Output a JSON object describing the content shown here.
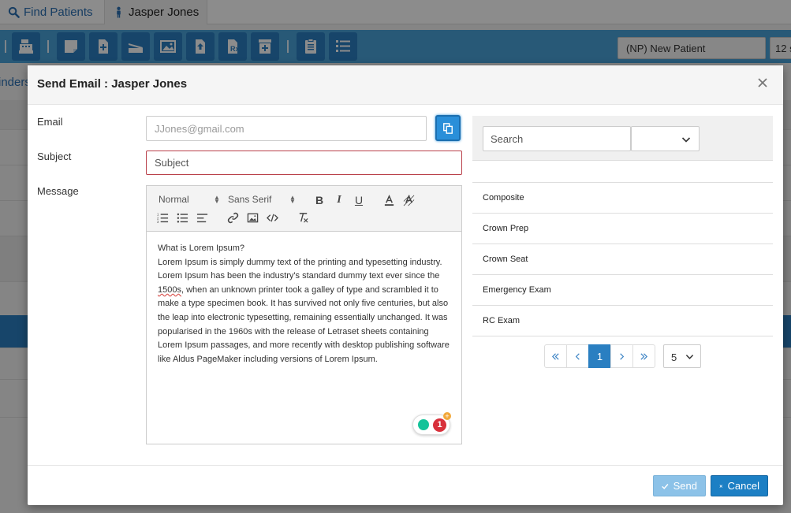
{
  "app": {
    "tabs": [
      {
        "label": "Find Patients",
        "icon": "search-icon"
      },
      {
        "label": "Jasper Jones",
        "icon": "person-icon"
      }
    ],
    "toolbar_icons": [
      "cash-register-icon",
      "note-icon",
      "add-document-icon",
      "scanner-icon",
      "image-icon",
      "upload-icon",
      "prescription-icon",
      "archive-add-icon",
      "clipboard-icon",
      "list-icon"
    ],
    "patient_type_select": "(NP) New Patient",
    "second_select": "12 s",
    "partial_link": "inders"
  },
  "modal": {
    "title": "Send Email : Jasper Jones",
    "email_label": "Email",
    "email_placeholder": "JJones@gmail.com",
    "subject_label": "Subject",
    "subject_placeholder": "Subject",
    "message_label": "Message",
    "editor": {
      "format_select": "Normal",
      "font_select": "Sans Serif",
      "body_heading": "What is Lorem Ipsum?",
      "body_text_1": "Lorem Ipsum is simply dummy text of the printing and typesetting industry. Lorem Ipsum has been the industry's standard dummy text ever since the ",
      "body_spell": "1500s",
      "body_text_2": ", when an unknown printer took a galley of type and scrambled it to make a type specimen book. It has survived not only five centuries, but also the leap into electronic typesetting, remaining essentially unchanged. It was popularised in the 1960s with the release of Letraset sheets containing Lorem Ipsum passages, and more recently with desktop publishing software like Aldus PageMaker including versions of Lorem Ipsum.",
      "grammarly_count": "1",
      "grammarly_plus": "+"
    },
    "templates": {
      "search_placeholder": "Search",
      "filter_value": "",
      "items": [
        "Composite",
        "Crown Prep",
        "Crown Seat",
        "Emergency Exam",
        "RC Exam"
      ]
    },
    "pager": {
      "current_page": "1",
      "page_size": "5"
    },
    "send_label": "Send",
    "cancel_label": "Cancel"
  },
  "colors": {
    "primary": "#1c7fc4",
    "primary_disabled": "#8cc2e8",
    "toolbar": "#4aa3d9",
    "invalid_border": "#b9404a"
  }
}
